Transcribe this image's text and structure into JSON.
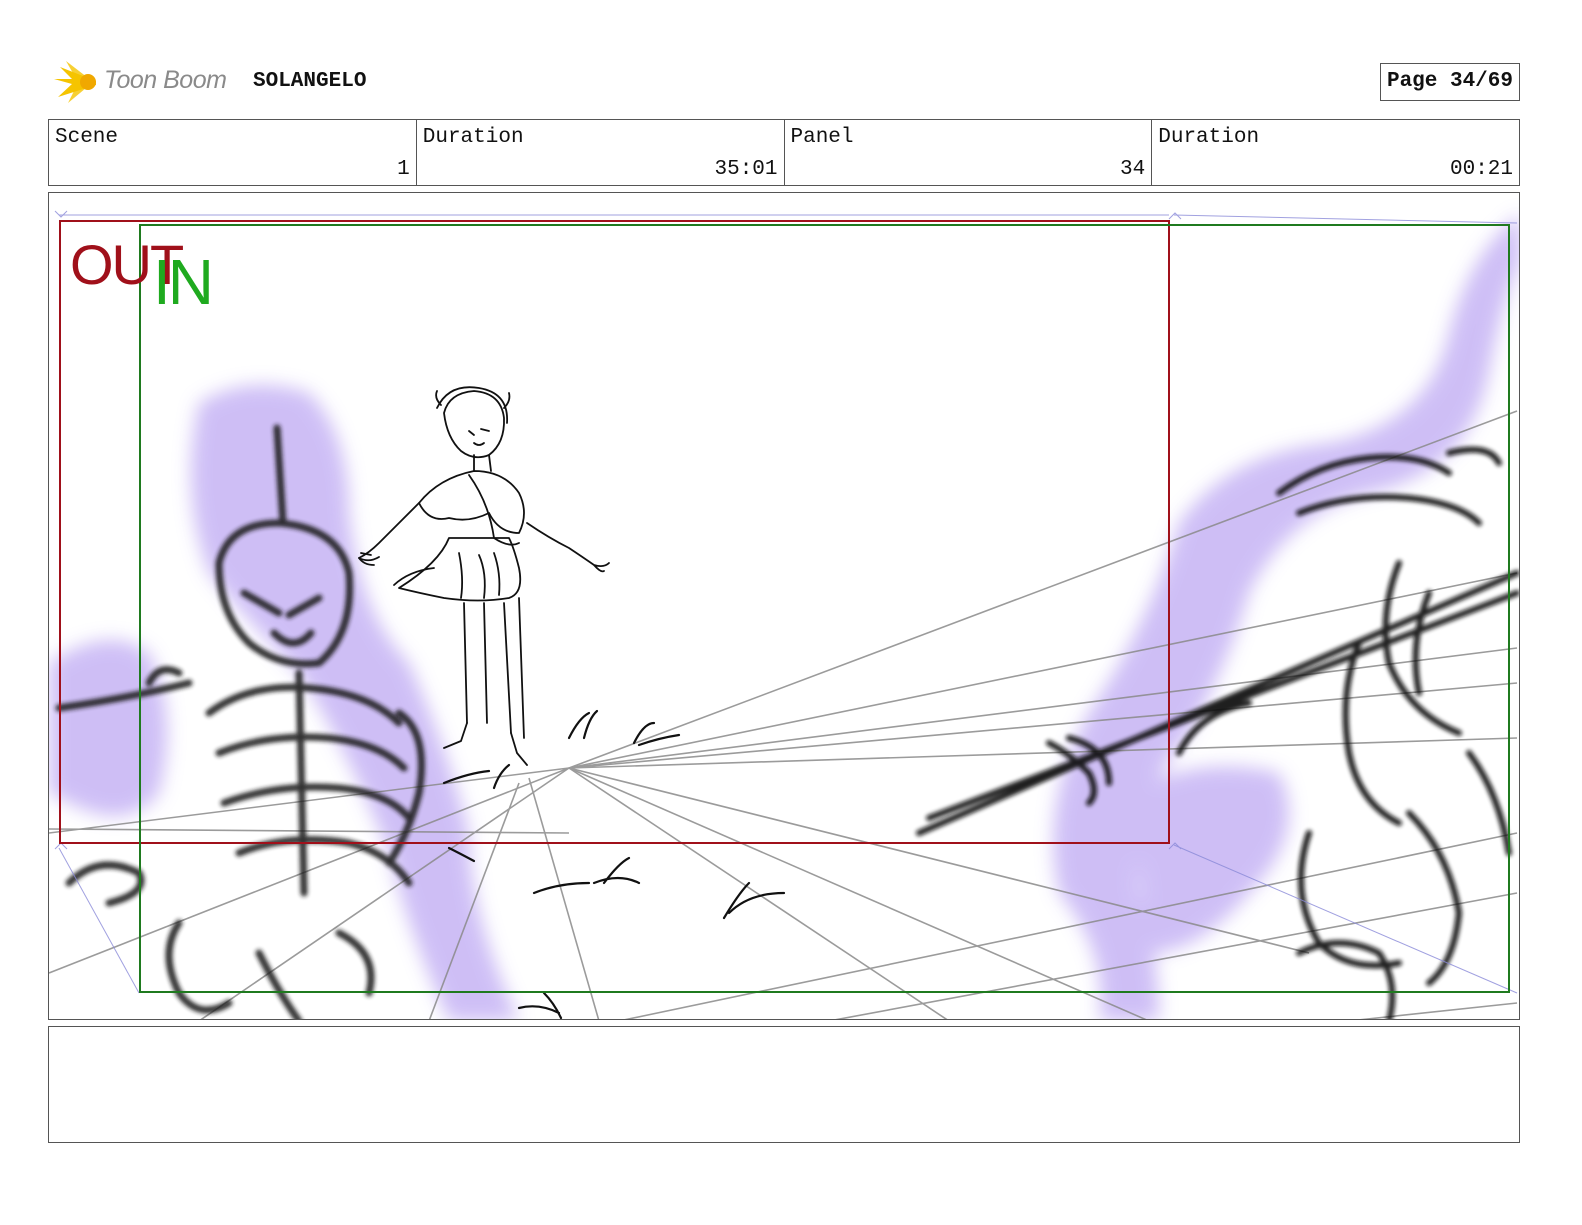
{
  "header": {
    "brand": "Toon Boom",
    "project": "SOLANGELO",
    "page_label": "Page 34/69"
  },
  "info": [
    {
      "label": "Scene",
      "value": "1"
    },
    {
      "label": "Duration",
      "value": "35:01"
    },
    {
      "label": "Panel",
      "value": "34"
    },
    {
      "label": "Duration",
      "value": "00:21"
    }
  ],
  "panel": {
    "out_label": "OUT",
    "in_label": "IN",
    "out_color": "#a0101a",
    "in_color": "#1faa1f",
    "glow_color": "#c9b8f5"
  },
  "notes": {
    "text": ""
  }
}
